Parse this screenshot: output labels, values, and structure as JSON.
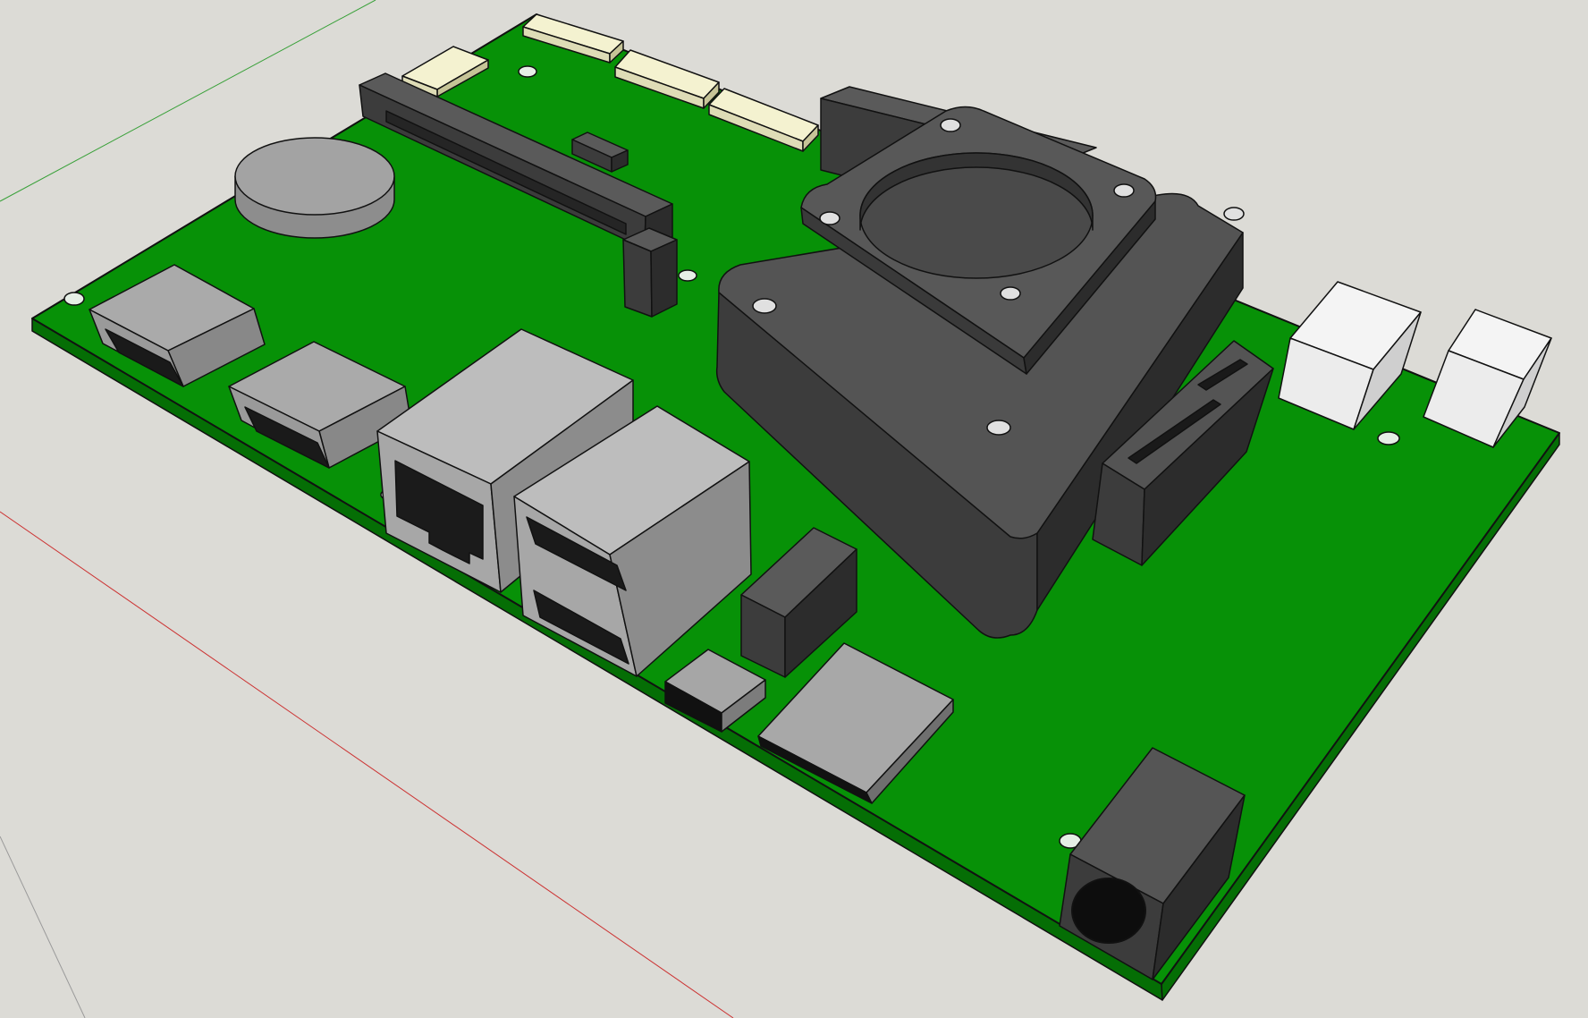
{
  "app": {
    "view": "3d-modeling-viewport",
    "model": "single-board-computer-pcb",
    "background_color": "#dcdbd6",
    "colors": {
      "pcb": "#079107",
      "pcb_edge": "#056e05",
      "dark_component": "#454545",
      "metal_connector": "#a5a5a5",
      "ribbon_connector": "#f4f2d0",
      "white_connector": "#f2f2f2",
      "outline": "#111111",
      "axis_green": "#3aa13a",
      "axis_red": "#cc3333"
    }
  },
  "components": [
    {
      "name": "pcb-board",
      "icon": "pcb-icon"
    },
    {
      "name": "coin-cell-battery",
      "icon": "battery-icon"
    },
    {
      "name": "pcie-slot",
      "icon": "slot-icon"
    },
    {
      "name": "ribbon-connector",
      "count": 4
    },
    {
      "name": "hdmi-port",
      "count": 2
    },
    {
      "name": "ethernet-port",
      "count": 1
    },
    {
      "name": "usb-port",
      "count": 2
    },
    {
      "name": "cpu-heatsink-fan",
      "icon": "fan-icon"
    },
    {
      "name": "sata-connector",
      "count": 1
    },
    {
      "name": "white-jst-connector",
      "count": 2
    },
    {
      "name": "header-block",
      "count": 1
    },
    {
      "name": "button-switch",
      "count": 1
    },
    {
      "name": "sd-card-slot",
      "count": 1
    },
    {
      "name": "dc-power-jack",
      "count": 1
    }
  ]
}
